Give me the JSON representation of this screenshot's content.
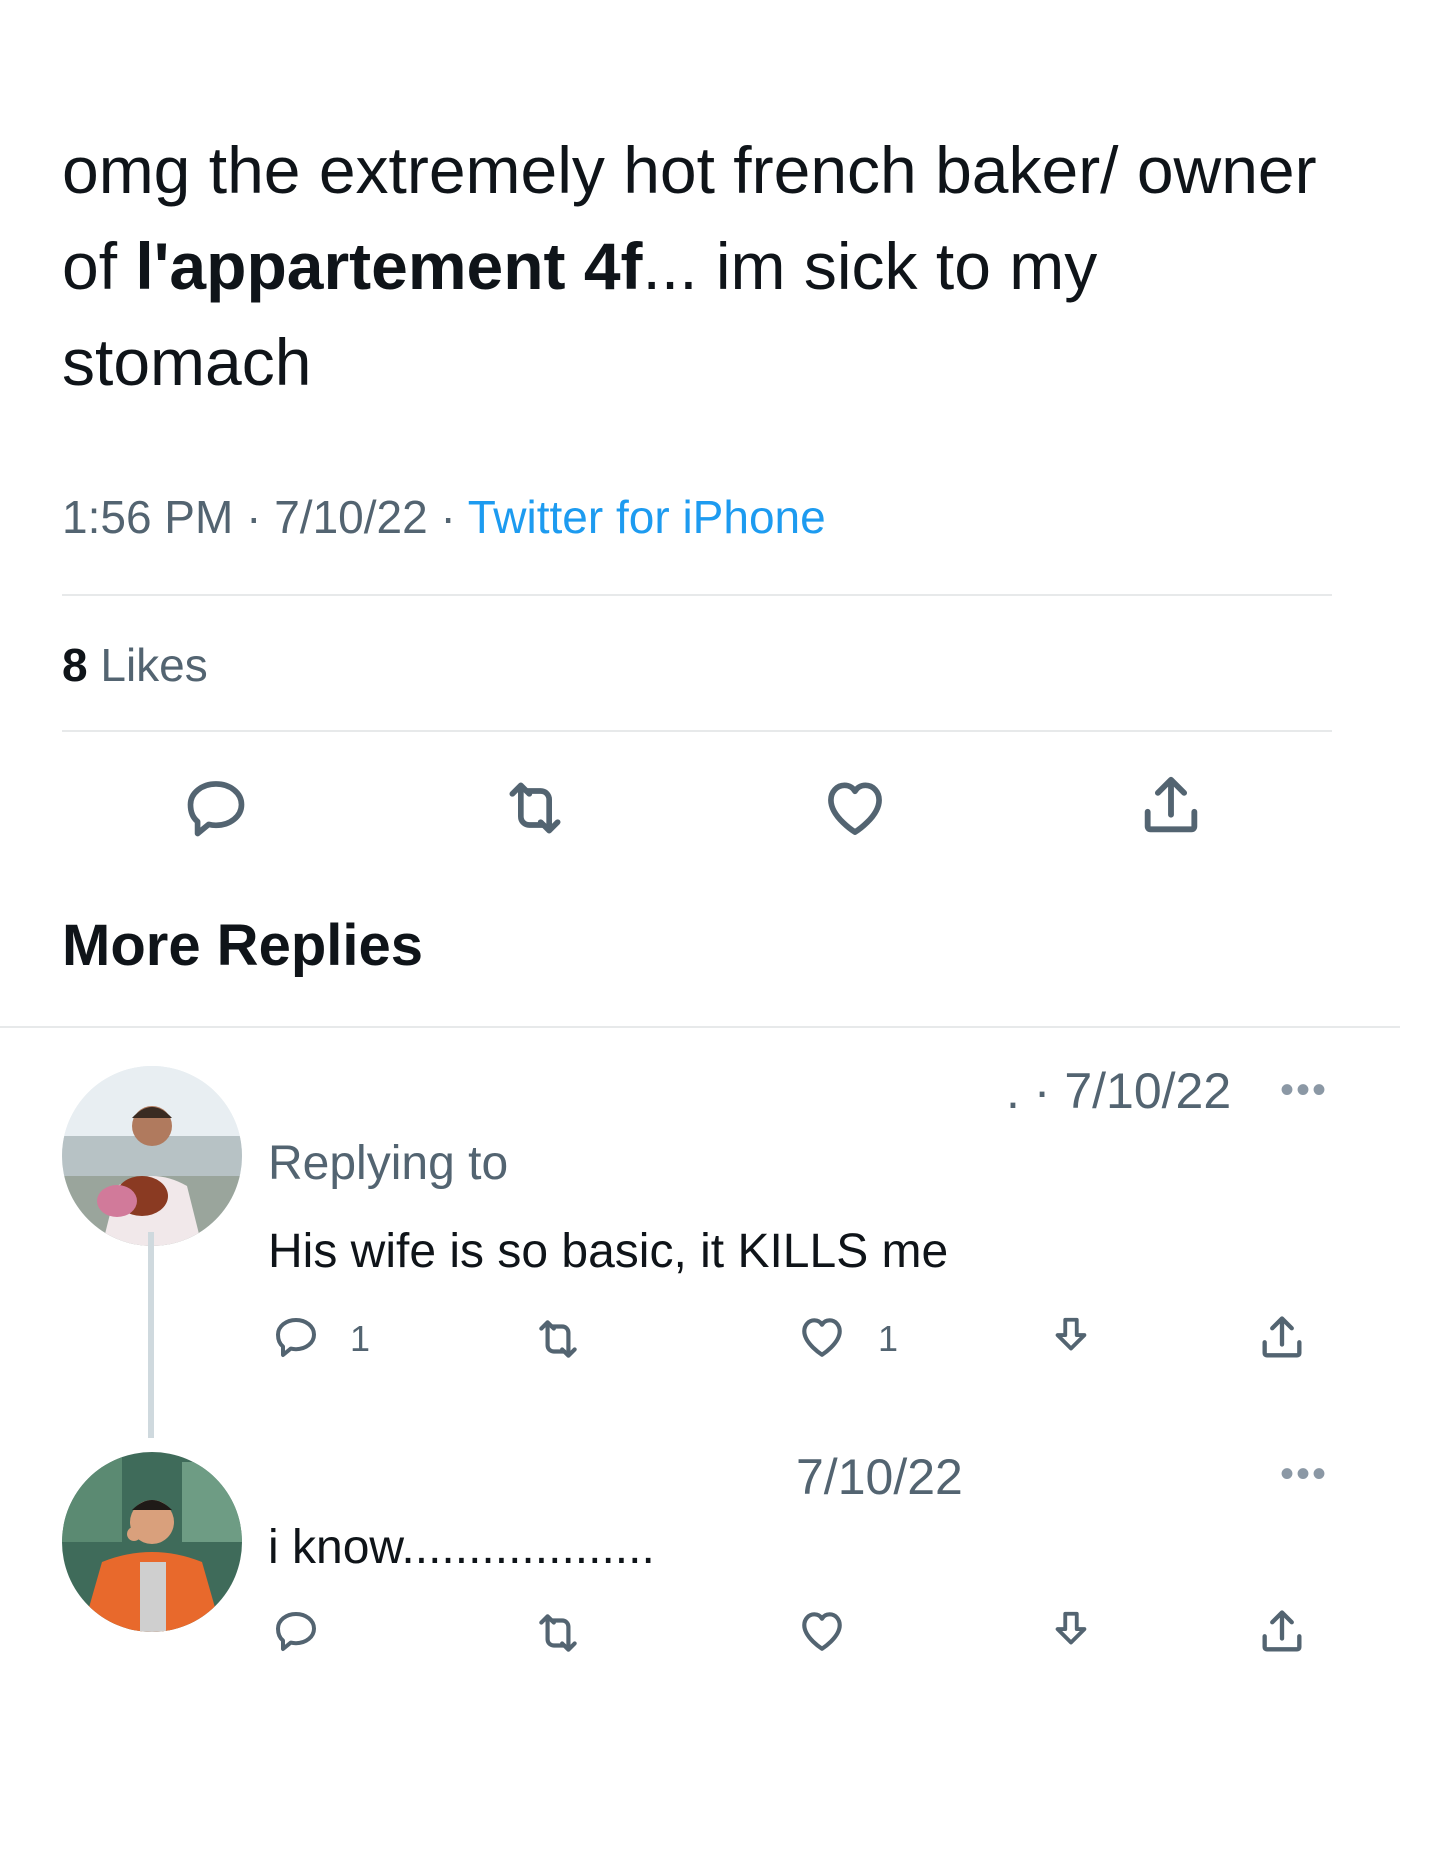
{
  "tweet": {
    "text_part1": "omg the extremely hot french baker/ owner of ",
    "text_bold": "l'appartement 4f",
    "text_part2": "... im sick to my stomach",
    "time": "1:56 PM",
    "sep1": " · ",
    "date": "7/10/22",
    "sep2": " · ",
    "source": "Twitter for iPhone",
    "likes_count": "8",
    "likes_label": " Likes"
  },
  "actions": {
    "reply_icon": "reply-icon",
    "retweet_icon": "retweet-icon",
    "like_icon": "heart-icon",
    "share_icon": "share-icon"
  },
  "section": {
    "title": "More Replies"
  },
  "replies": [
    {
      "date_prefix": ". · ",
      "date": "7/10/22",
      "more": "•••",
      "replying_to": "Replying to",
      "text": "His wife is so basic, it KILLS me",
      "reply_count": "1",
      "like_count": "1"
    },
    {
      "date": "7/10/22",
      "more": "•••",
      "text": "i know..................."
    }
  ],
  "colors": {
    "text": "#0f1419",
    "secondary": "#536471",
    "link": "#1d9bf0",
    "divider": "#e7e9ea"
  }
}
